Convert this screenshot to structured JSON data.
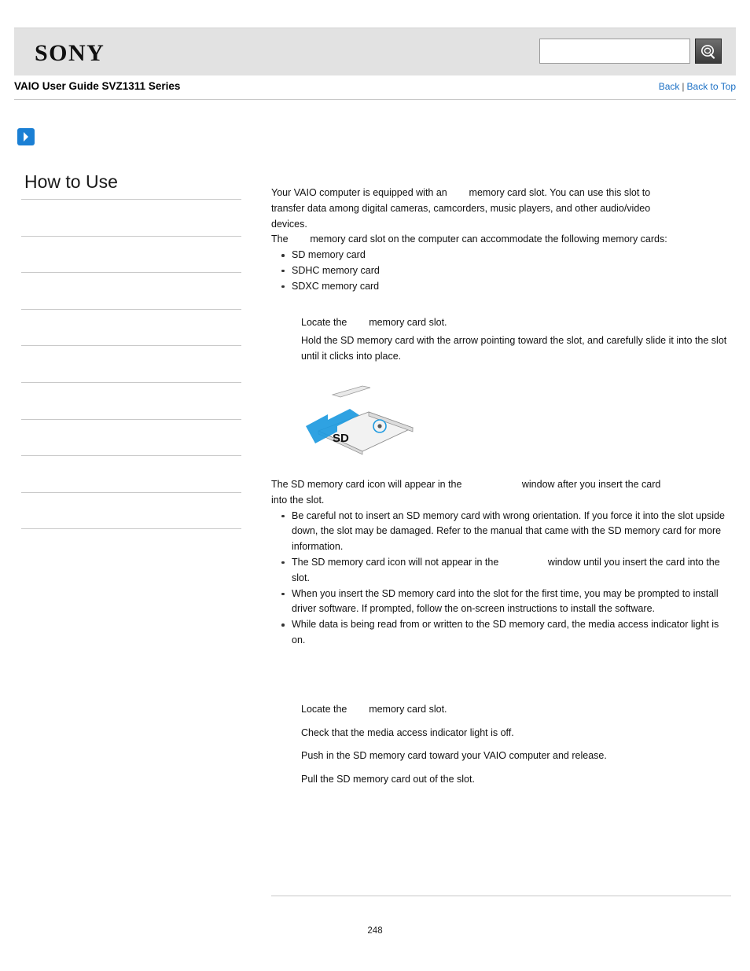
{
  "header": {
    "logo_text": "SONY",
    "search": {
      "value": "",
      "placeholder": "",
      "button_icon": "search-icon"
    }
  },
  "title_row": {
    "guide_title": "VAIO User Guide SVZ1311 Series",
    "back_label": "Back",
    "separator": "|",
    "back_to_top_label": "Back to Top"
  },
  "sidebar": {
    "heading": "How to Use",
    "items": [
      "",
      "",
      "",
      "",
      "",
      "",
      "",
      "",
      "",
      ""
    ]
  },
  "content": {
    "intro": {
      "line1_part1": "Your VAIO computer is equipped with an",
      "line1_part2": "memory card slot. You can use this slot to",
      "line2": "transfer data among digital cameras, camcorders, music players, and other audio/video",
      "line3": "devices.",
      "line4_part1": "The",
      "line4_part2": "memory card slot on the computer can accommodate the following memory cards:"
    },
    "card_types": [
      "SD memory card",
      "SDHC memory card",
      "SDXC memory card"
    ],
    "insert_steps": [
      {
        "part1": "Locate the",
        "part2": "memory card slot."
      },
      {
        "part1": "Hold the SD memory card with the arrow pointing toward the slot, and carefully slide it",
        "part2": "into the slot until it clicks into place."
      }
    ],
    "figure": {
      "label": "SD",
      "alt_name": "sd-card-insertion-illustration"
    },
    "after_figure": {
      "part1": "The SD memory card icon will appear in the",
      "part2": "window after you insert the card",
      "line2": "into the slot."
    },
    "notes": [
      "Be careful not to insert an SD memory card with wrong orientation. If you force it into the slot upside down, the slot may be damaged. Refer to the manual that came with the SD memory card for more information.",
      {
        "part1": "The SD memory card icon will not appear in the",
        "part2": "window until you insert the",
        "part3": "card into the slot."
      }
    ],
    "hints": [
      "When you insert the SD memory card into the slot for the first time, you may be prompted to install driver software. If prompted, follow the on-screen instructions to install the software.",
      "While data is being read from or written to the SD memory card, the media access indicator light is on."
    ],
    "eject_steps": [
      {
        "part1": "Locate the",
        "part2": "memory card slot."
      },
      {
        "part1": "Check that the media access indicator light is off.",
        "part2": ""
      },
      {
        "part1": "Push in the SD memory card toward your VAIO computer and release.",
        "part2": ""
      },
      {
        "part1": "Pull the SD memory card out of the slot.",
        "part2": ""
      }
    ]
  },
  "footer": {
    "page_number": "248"
  }
}
